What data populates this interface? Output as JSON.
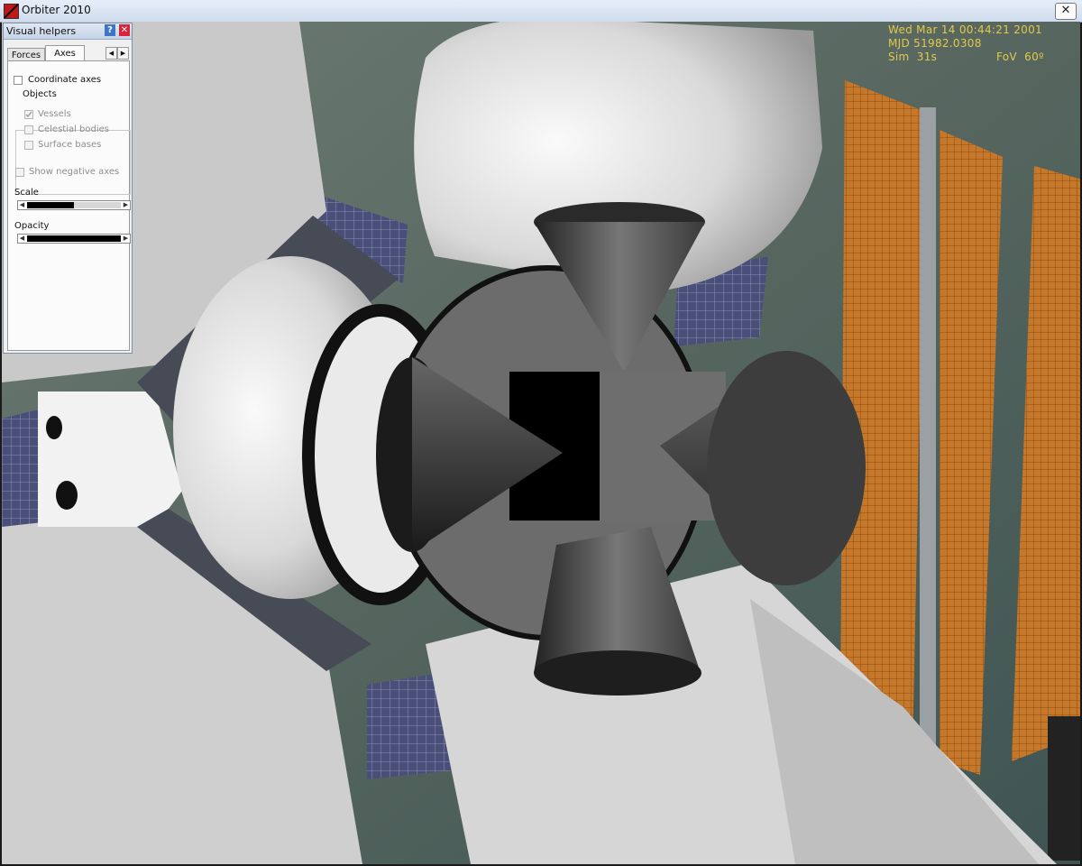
{
  "window": {
    "title": "Orbiter 2010",
    "close_glyph": "✕"
  },
  "hud": {
    "date": "Wed Mar 14 00:44:21 2001",
    "mjd": "MJD 51982.0308",
    "sim": "Sim  31s",
    "fov": "FoV  60º"
  },
  "dialog": {
    "title": "Visual helpers",
    "help_glyph": "?",
    "close_glyph": "✕",
    "tabs": [
      "Forces",
      "Axes"
    ],
    "active_tab": "Axes",
    "coordinate_axes_label": "Coordinate axes",
    "objects_group_label": "Objects",
    "objects": [
      {
        "label": "Vessels",
        "checked": true,
        "enabled": false
      },
      {
        "label": "Celestial bodies",
        "checked": false,
        "enabled": false
      },
      {
        "label": "Surface bases",
        "checked": false,
        "enabled": false
      }
    ],
    "show_negative_axes_label": "Show negative axes",
    "scale_label": "Scale",
    "scale_fraction": 0.5,
    "opacity_label": "Opacity",
    "opacity_fraction": 1.0
  },
  "colors": {
    "hud": "#e3c84a",
    "solar_panel": "#c6782a",
    "earth": "#5f6e66"
  }
}
